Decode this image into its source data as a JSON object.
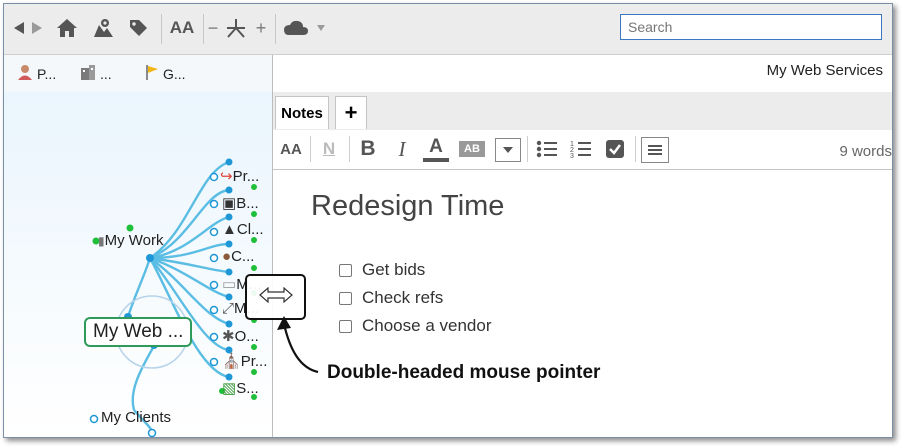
{
  "toolbar": {
    "icons": [
      "back-arrow-icon",
      "forward-arrow-icon",
      "home-icon",
      "map-icon",
      "tag-icon",
      "font-size-icon",
      "collapse-icon",
      "branch-icon",
      "expand-icon",
      "cloud-icon",
      "dropdown-icon"
    ],
    "font_label": "AA",
    "minus_label": "−",
    "plus_label": "+"
  },
  "search": {
    "placeholder": "Search"
  },
  "quick_links": [
    {
      "label": "P...",
      "icon": "person-icon"
    },
    {
      "label": "...",
      "icon": "building-icon"
    },
    {
      "label": "G...",
      "icon": "flag-icon"
    }
  ],
  "mindmap": {
    "central_topic": "My Web ...",
    "work_node": "My Work",
    "clients_node": "My Clients",
    "children": [
      "Pr...",
      "B...",
      "Cl...",
      "C...",
      "M...",
      "M...",
      "O...",
      "Pr...",
      "S..."
    ]
  },
  "panel": {
    "header": "My Web Services",
    "tab_notes": "Notes",
    "tab_add": "+",
    "word_count": "9 words"
  },
  "note": {
    "title": "Redesign Time",
    "tasks": [
      "Get bids",
      "Check refs",
      "Choose a vendor"
    ]
  },
  "format_bar": {
    "font_label": "AA",
    "normal_label": "N",
    "bold_label": "B",
    "italic_label": "I",
    "color_label": "A",
    "highlight_label": "AB"
  },
  "annotation": {
    "callout": "Double-headed mouse pointer"
  },
  "colors": {
    "accent": "#3a78c4",
    "branch": "#5bbde3",
    "dot_green": "#1fbf3a",
    "central_border": "#2e9b5a"
  }
}
